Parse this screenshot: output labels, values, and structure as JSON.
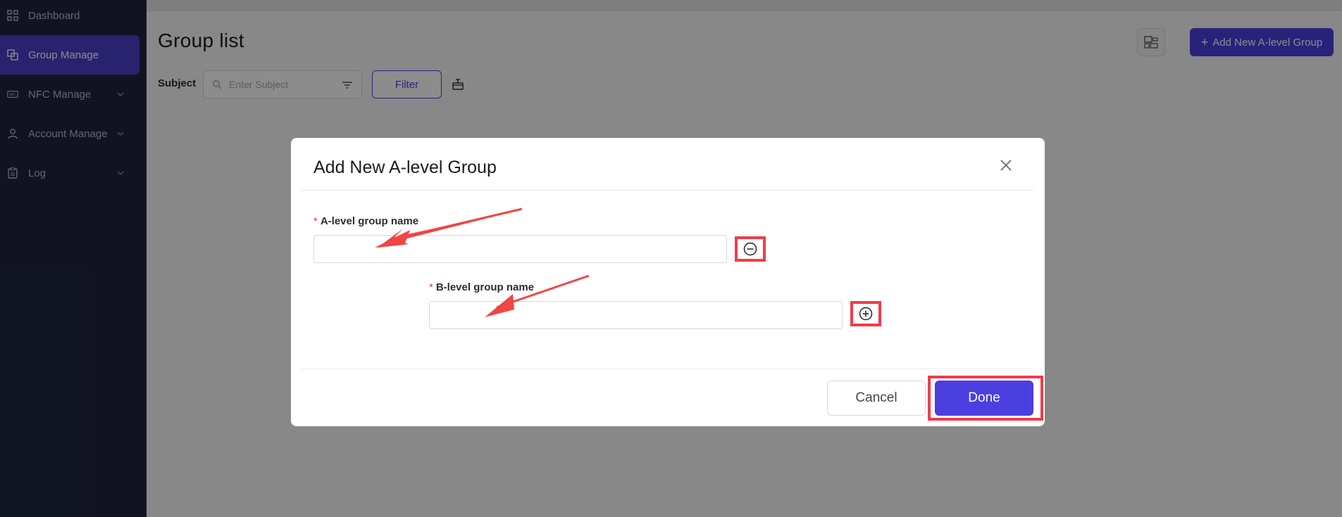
{
  "sidebar": {
    "items": [
      {
        "label": "Dashboard",
        "icon": "dashboard-icon",
        "active": false,
        "has_chevron": false
      },
      {
        "label": "Group Manage",
        "icon": "group-icon",
        "active": true,
        "has_chevron": false
      },
      {
        "label": "NFC Manage",
        "icon": "nfc-icon",
        "active": false,
        "has_chevron": true
      },
      {
        "label": "Account Manage",
        "icon": "user-icon",
        "active": false,
        "has_chevron": true
      },
      {
        "label": "Log",
        "icon": "clipboard-icon",
        "active": false,
        "has_chevron": true
      }
    ]
  },
  "page": {
    "title": "Group list",
    "add_button_label": "Add New A-level Group",
    "subject_label": "Subject",
    "subject_placeholder": "Enter Subject",
    "filter_label": "Filter"
  },
  "modal": {
    "title": "Add New A-level Group",
    "a_level_label": "A-level group name",
    "a_level_value": "",
    "b_level_label": "B-level group name",
    "b_level_value": "",
    "required_mark": "*",
    "cancel_label": "Cancel",
    "done_label": "Done"
  },
  "colors": {
    "sidebar_bg": "#1f2440",
    "accent": "#4b3fe0",
    "annotation_red": "#ef3d4a"
  }
}
